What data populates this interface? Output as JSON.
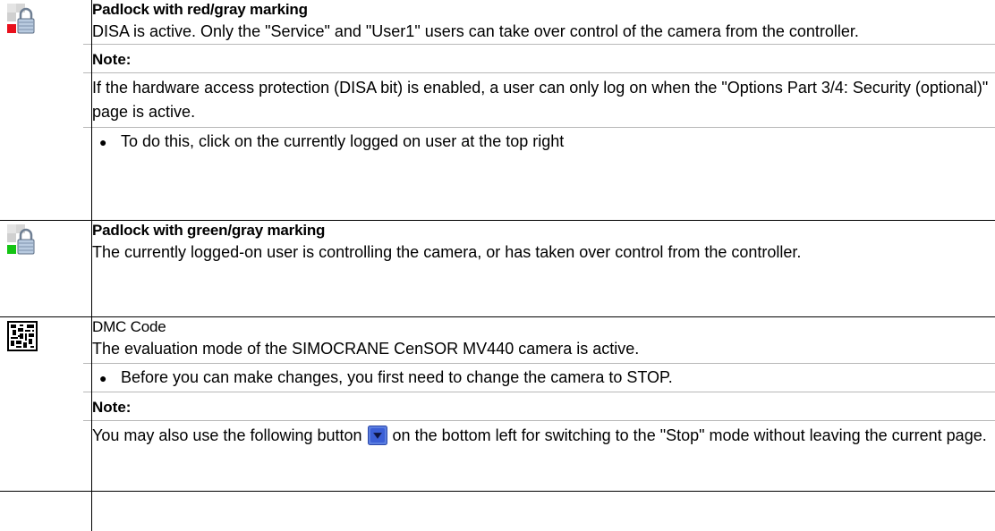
{
  "rows": [
    {
      "icon": "padlock-red-gray-icon",
      "title": "Padlock with red/gray marking",
      "text": "DISA is active. Only the \"Service\" and \"User1\" users can take over control of the camera from the controller.",
      "note_label": "Note:",
      "note_text": "If the hardware access protection (DISA bit) is enabled, a user can only log on when the \"Options Part 3/4: Security (optional)\" page is active.",
      "bullet": "To do this, click on the currently logged on user at the top right"
    },
    {
      "icon": "padlock-green-gray-icon",
      "title": "Padlock with green/gray marking",
      "text": "The currently logged-on user is controlling the camera, or has taken over control from the controller."
    },
    {
      "icon": "dmc-code-icon",
      "title": "DMC Code",
      "text": "The evaluation mode of the SIMOCRANE CenSOR MV440 camera is active.",
      "bullet": "Before you can make changes, you first need to change the camera to STOP.",
      "note_label": "Note:",
      "note_text_before": "You may also use the following button",
      "note_text_after": "on the bottom left for switching to the \"Stop\" mode without leaving the current page."
    }
  ],
  "colors": {
    "red_marking": "#e8101c",
    "green_marking": "#14c414",
    "stop_button": "#3b5fd6"
  }
}
